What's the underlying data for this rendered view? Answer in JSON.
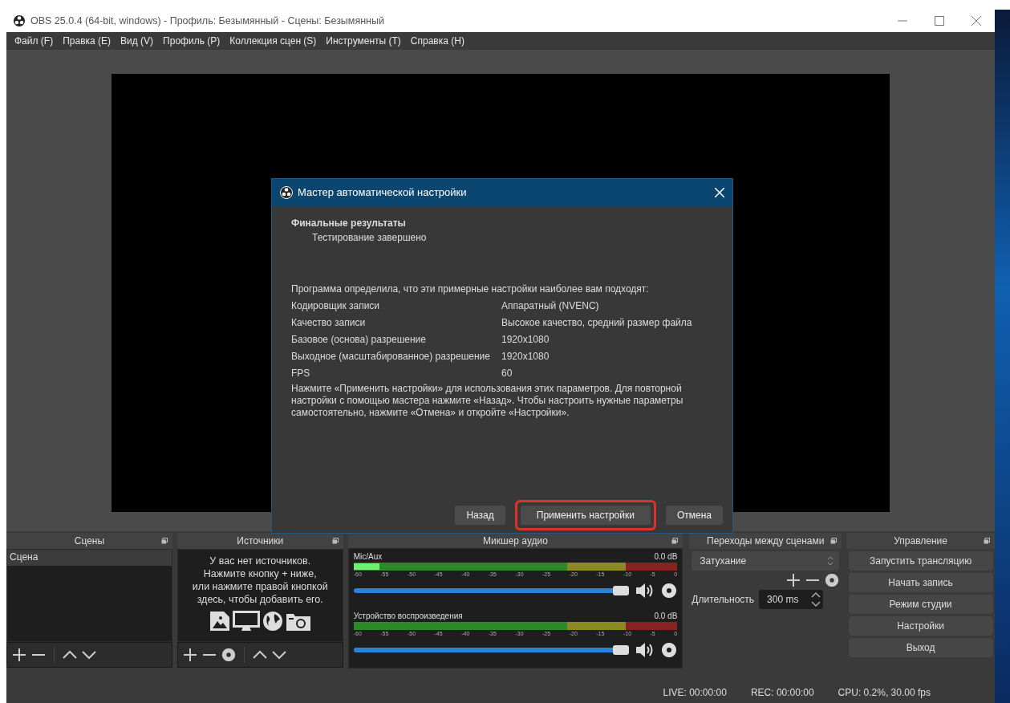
{
  "window": {
    "title": "OBS 25.0.4 (64-bit, windows) - Профиль: Безымянный - Сцены: Безымянный"
  },
  "menu": [
    "Файл (F)",
    "Правка (E)",
    "Вид (V)",
    "Профиль (P)",
    "Коллекция сцен (S)",
    "Инструменты (T)",
    "Справка (H)"
  ],
  "dialog": {
    "title": "Мастер автоматической настройки",
    "heading": "Финальные результаты",
    "subheading": "Тестирование завершено",
    "intro": "Программа определила, что эти примерные настройки наиболее вам подходят:",
    "settings": [
      {
        "label": "Кодировщик записи",
        "value": "Аппаратный (NVENC)"
      },
      {
        "label": "Качество записи",
        "value": "Высокое качество, средний размер файла"
      },
      {
        "label": "Базовое (основа) разрешение",
        "value": "1920x1080"
      },
      {
        "label": "Выходное (масштабированное) разрешение",
        "value": "1920x1080"
      },
      {
        "label": "FPS",
        "value": "60"
      }
    ],
    "note": "Нажмите «Применить настройки» для использования этих параметров. Для повторной настройки с помощью мастера нажмите «Назад». Чтобы настроить нужные параметры самостоятельно, нажмите «Отмена» и откройте «Настройки».",
    "buttons": [
      {
        "label": "Назад",
        "highlighted": false
      },
      {
        "label": "Применить настройки",
        "highlighted": true
      },
      {
        "label": "Отмена",
        "highlighted": false
      }
    ]
  },
  "scenes": {
    "title": "Сцены",
    "items": [
      {
        "label": "Сцена",
        "selected": true
      }
    ]
  },
  "sources": {
    "title": "Источники",
    "empty_text": "У вас нет источников.\nНажмите кнопку + ниже,\nили нажмите правой кнопкой\nздесь, чтобы добавить его."
  },
  "mixer": {
    "title": "Микшер аудио",
    "channels": [
      {
        "name": "Mic/Aux",
        "reading": "0.0 dB",
        "meter": {
          "level": 0.08
        },
        "volume": {
          "level": 1
        },
        "ticks": [
          "-60",
          "-55",
          "-50",
          "-45",
          "-40",
          "-35",
          "-30",
          "-25",
          "-20",
          "-15",
          "-10",
          "-5",
          "0"
        ]
      },
      {
        "name": "Устройство воспроизведения",
        "reading": "0.0 dB",
        "meter": {
          "level": 0
        },
        "volume": {
          "level": 1
        },
        "ticks": [
          "-60",
          "-55",
          "-50",
          "-45",
          "-40",
          "-35",
          "-30",
          "-25",
          "-20",
          "-15",
          "-10",
          "-5",
          "0"
        ]
      }
    ]
  },
  "transitions": {
    "title": "Переходы между сценами",
    "transition": "Затухание",
    "duration_label": "Длительность",
    "duration": "300 ms"
  },
  "controls": {
    "title": "Управление",
    "buttons": [
      "Запустить трансляцию",
      "Начать запись",
      "Режим студии",
      "Настройки",
      "Выход"
    ]
  },
  "status_bar": [
    "LIVE: 00:00:00",
    "REC: 00:00:00",
    "CPU: 0.2%, 30.00 fps"
  ]
}
